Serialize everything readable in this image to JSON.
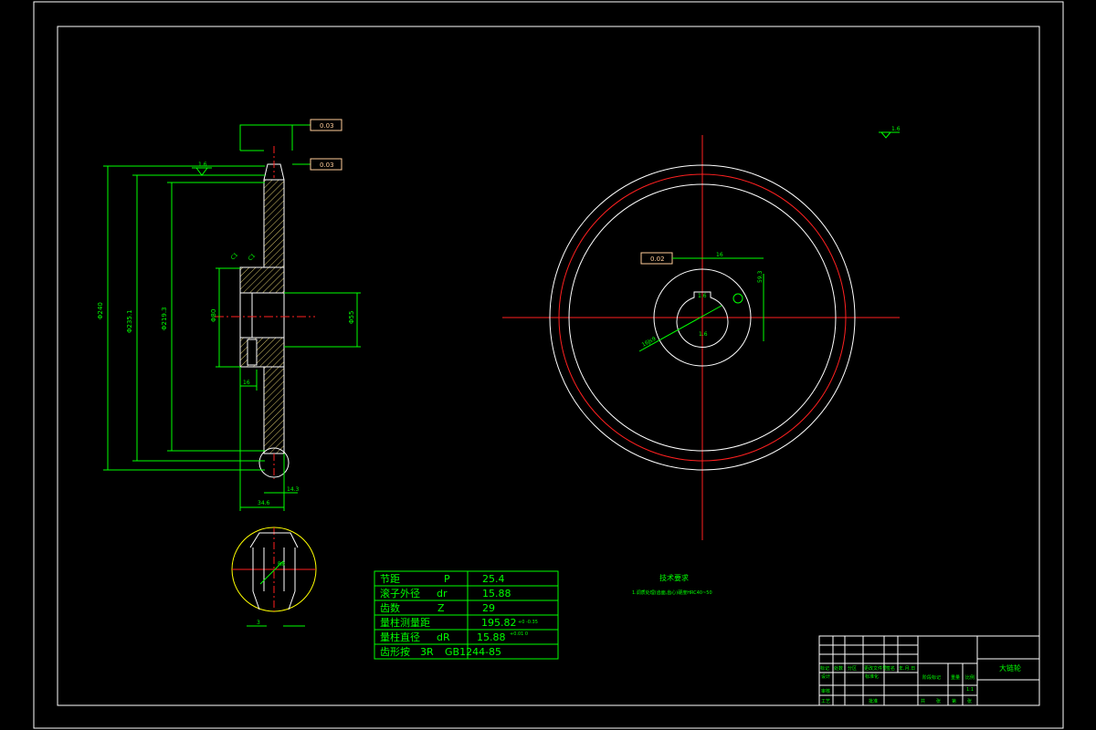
{
  "colors": {
    "background": "#000000",
    "frame": "#ffffff",
    "dimension": "#00ff00",
    "centerline": "#ff2020",
    "section": "#ffff00",
    "tolerance": "#ffcc99",
    "hatch": "#d4c36a",
    "table_text": "#00ff00"
  },
  "param_table": {
    "rows": [
      {
        "name": "节距",
        "symbol": "P",
        "value": "25.4",
        "tol": ""
      },
      {
        "name": "滚子外径",
        "symbol": "dr",
        "value": "15.88",
        "tol": ""
      },
      {
        "name": "齿数",
        "symbol": "Z",
        "value": "29",
        "tol": ""
      },
      {
        "name": "量柱测量距",
        "symbol": "",
        "value": "195.82",
        "tol": "+0 -0.35"
      },
      {
        "name": "量柱直径",
        "symbol": "dR",
        "value": "15.88",
        "tol": "+0.01 0"
      },
      {
        "name": "齿形按",
        "symbol": "3R",
        "value": "GB1244-85",
        "tol": ""
      }
    ]
  },
  "notes": {
    "title": "技术要求",
    "line1": "1.调质处理(齿面,齿心)硬度HRC40~50"
  },
  "title_block": {
    "part_name": "大链轮",
    "scale": "1:1",
    "cells": [
      "标记",
      "处数",
      "分区",
      "更改文件号",
      "签名",
      "年.月.日",
      "设计",
      "标准化",
      "审核",
      "工艺",
      "批准",
      "阶段标记",
      "重量",
      "比例",
      "共",
      "张",
      "第",
      "张"
    ]
  },
  "annotations": {
    "roughness_top": "1.6",
    "roughness_corner": "1.6",
    "tol_frame_top": "0.03",
    "tol_frame_mid": "0.03",
    "tol_frame_right": "0.02",
    "dim_overall": "Φ240",
    "dim_pitch": "Φ235.1",
    "dim_root": "Φ219.3",
    "dim_bore": "Φ55",
    "dim_hub": "Φ80",
    "dim_width": "34.6",
    "dim_tooth": "14.3",
    "dim_keyway": "16",
    "dim_keywidth": "16Js9",
    "dim_keydepth": "59.3",
    "dim_chamfer1": "C1",
    "dim_chamfer2": "C1",
    "detail_dim1": "3",
    "detail_dim2": "R8"
  }
}
